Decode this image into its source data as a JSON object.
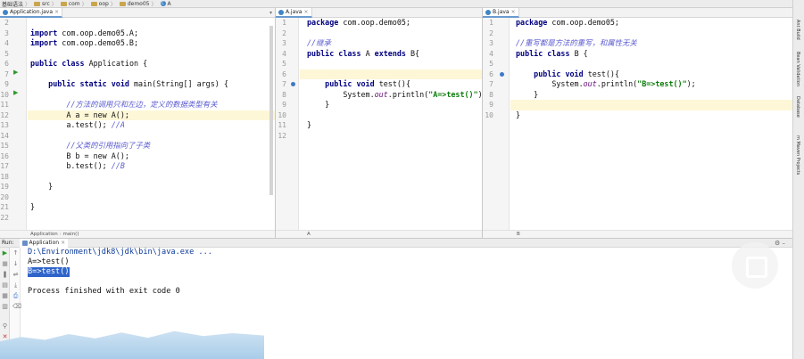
{
  "breadcrumb": [
    "基础语法",
    "src",
    "com",
    "oop",
    "demo05",
    "A"
  ],
  "pane_left": {
    "tab": "Application.java",
    "status": [
      "Application",
      "main()"
    ],
    "lines": [
      {
        "n": "2",
        "t": ""
      },
      {
        "n": "3",
        "t": "import com.oop.demo05.A;"
      },
      {
        "n": "4",
        "t": "import com.oop.demo05.B;"
      },
      {
        "n": "5",
        "t": ""
      },
      {
        "n": "6",
        "t": "public class Application {"
      },
      {
        "n": "7",
        "t": ""
      },
      {
        "n": "9",
        "t": "    public static void main(String[] args) {"
      },
      {
        "n": "10",
        "t": ""
      },
      {
        "n": "11",
        "t": "        //方法的调用只和左边，定义的数据类型有关"
      },
      {
        "n": "12",
        "t": "        A a = new A();"
      },
      {
        "n": "13",
        "t": "        a.test(); //A"
      },
      {
        "n": "14",
        "t": ""
      },
      {
        "n": "15",
        "t": "        //父类的引用指向了子类"
      },
      {
        "n": "16",
        "t": "        B b = new A();"
      },
      {
        "n": "17",
        "t": "        b.test(); //B"
      },
      {
        "n": "18",
        "t": ""
      },
      {
        "n": "19",
        "t": "    }"
      },
      {
        "n": "20",
        "t": ""
      },
      {
        "n": "21",
        "t": "}"
      },
      {
        "n": "22",
        "t": ""
      }
    ]
  },
  "pane_mid": {
    "tab": "A.java",
    "status": [
      "A"
    ],
    "lines": [
      {
        "n": "1",
        "t": "package com.oop.demo05;"
      },
      {
        "n": "2",
        "t": ""
      },
      {
        "n": "3",
        "t": "//继承"
      },
      {
        "n": "4",
        "t": "public class A extends B{"
      },
      {
        "n": "5",
        "t": ""
      },
      {
        "n": "6",
        "t": ""
      },
      {
        "n": "7",
        "t": "    public void test(){"
      },
      {
        "n": "8",
        "t": "        System.out.println(\"A=>test()\");"
      },
      {
        "n": "9",
        "t": "    }"
      },
      {
        "n": "10",
        "t": ""
      },
      {
        "n": "11",
        "t": "}"
      },
      {
        "n": "12",
        "t": ""
      }
    ]
  },
  "pane_right": {
    "tab": "B.java",
    "status": [
      "B"
    ],
    "lines": [
      {
        "n": "1",
        "t": "package com.oop.demo05;"
      },
      {
        "n": "2",
        "t": ""
      },
      {
        "n": "3",
        "t": "//重写都是方法的重写，和属性无关"
      },
      {
        "n": "4",
        "t": "public class B {"
      },
      {
        "n": "5",
        "t": ""
      },
      {
        "n": "6",
        "t": "    public void test(){"
      },
      {
        "n": "7",
        "t": "        System.out.println(\"B=>test()\");"
      },
      {
        "n": "8",
        "t": "    }"
      },
      {
        "n": "9",
        "t": ""
      },
      {
        "n": "10",
        "t": "}"
      }
    ]
  },
  "right_tools": [
    "Ant Build",
    "m Maven Projects",
    "Database",
    "Bean Validation"
  ],
  "run": {
    "label": "Run:",
    "tab": "Application",
    "console": [
      "D:\\Environment\\jdk8\\jdk\\bin\\java.exe ...",
      "A=>test()",
      "B=>test()",
      "",
      "Process finished with exit code 0"
    ]
  },
  "colors": {
    "keyword": "#000080",
    "comment": "#5a5ad0",
    "string": "#0a7d0a",
    "highlight_row": "#fdf7d7",
    "selection": "#2f65ca"
  }
}
